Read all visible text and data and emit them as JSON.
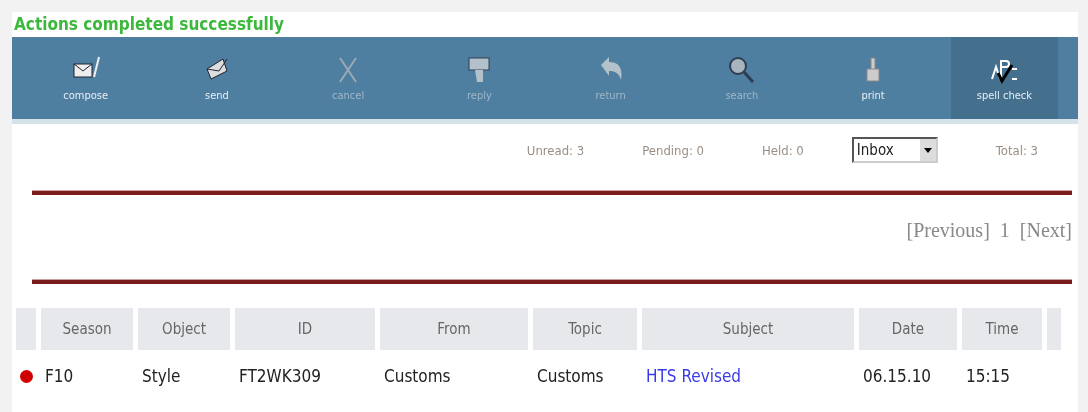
{
  "status_message": "Actions completed successfully",
  "toolbar": [
    {
      "label": "compose",
      "kind": "compose",
      "disabled": false,
      "selected": false
    },
    {
      "label": "send",
      "kind": "send",
      "disabled": false,
      "selected": false
    },
    {
      "label": "cancel",
      "kind": "cancel",
      "disabled": true,
      "selected": false
    },
    {
      "label": "reply",
      "kind": "reply",
      "disabled": true,
      "selected": false
    },
    {
      "label": "return",
      "kind": "return",
      "disabled": true,
      "selected": false
    },
    {
      "label": "search",
      "kind": "search",
      "disabled": true,
      "selected": false
    },
    {
      "label": "print",
      "kind": "print",
      "disabled": false,
      "selected": false
    },
    {
      "label": "spell check",
      "kind": "spell",
      "disabled": false,
      "selected": true
    }
  ],
  "counts": {
    "unread": "Unread: 3",
    "pending": "Pending: 0",
    "held": "Held: 0",
    "folder": "Inbox",
    "total": "Total: 3"
  },
  "pagination": {
    "previous": "[Previous]",
    "page": "1",
    "next": "[Next]"
  },
  "table": {
    "columns": [
      "Season",
      "Object",
      "ID",
      "From",
      "Topic",
      "Subject",
      "Date",
      "Time"
    ],
    "rows": [
      {
        "color": "#d00000",
        "cells": [
          "F10",
          "Style",
          "FT2WK309",
          "Customs",
          "Customs",
          "HTS Revised",
          "06.15.10",
          "15:15"
        ]
      }
    ]
  }
}
